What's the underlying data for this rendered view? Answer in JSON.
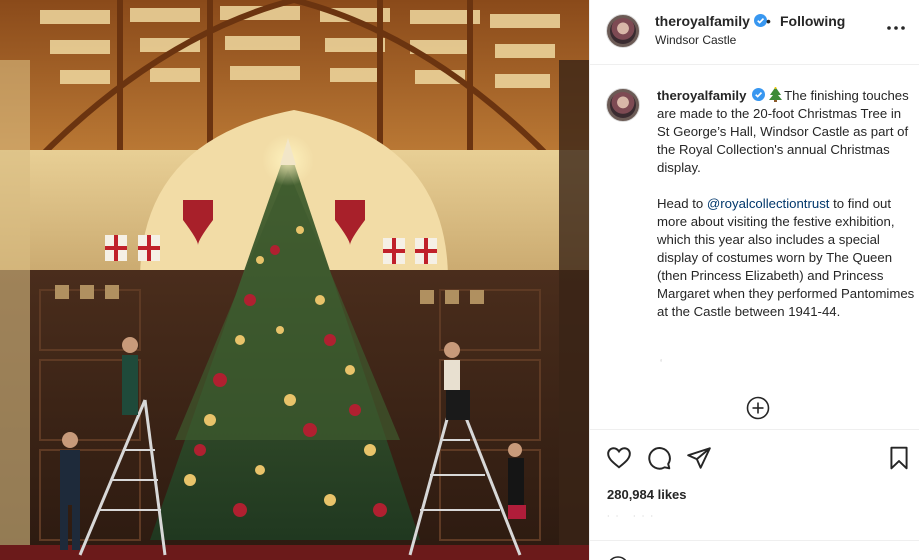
{
  "post": {
    "username": "theroyalfamily",
    "separator": "•",
    "follow_state": "Following",
    "location": "Windsor Castle",
    "caption": {
      "username": "theroyalfamily",
      "paragraph1": "The finishing touches are made to the 20-foot Christmas Tree in St George’s Hall, Windsor Castle as part of the Royal Collection's annual Christmas display.",
      "paragraph2_before": "Head to ",
      "mention": "@royalcollectiontrust",
      "paragraph2_after": " to find out more about visiting the festive exhibition, which this year also includes a special display of costumes worn by The Queen (then Princess Elizabeth) and Princess Margaret when they performed Pantomimes at the Castle between 1941-44."
    },
    "faint_mark": "‘",
    "likes": "280,984 likes"
  },
  "icons": {
    "verified": "verified-badge-icon",
    "more": "more-options-icon",
    "tree_emoji": "christmas-tree-emoji",
    "load_more": "plus-circle-icon",
    "like": "heart-icon",
    "comment": "comment-bubble-icon",
    "share": "paper-plane-icon",
    "save": "bookmark-icon",
    "emoji": "smiley-icon"
  },
  "colors": {
    "text": "#262626",
    "mention": "#00376b",
    "verified": "#3897f0",
    "border": "#efefef"
  }
}
